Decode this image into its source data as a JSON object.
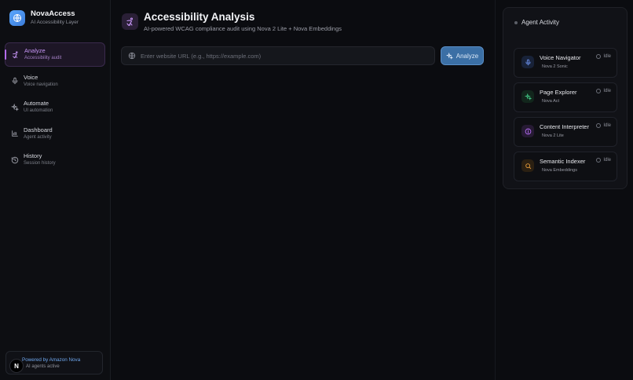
{
  "brand": {
    "title": "NovaAccess",
    "subtitle": "AI Accessibility Layer"
  },
  "sidebar": {
    "items": [
      {
        "label": "Analyze",
        "sub": "Accessibility audit",
        "icon": "accessibility-icon",
        "active": true
      },
      {
        "label": "Voice",
        "sub": "Voice navigation",
        "icon": "microphone-icon"
      },
      {
        "label": "Automate",
        "sub": "UI automation",
        "icon": "sparkle-icon"
      },
      {
        "label": "Dashboard",
        "sub": "Agent activity",
        "icon": "bar-chart-icon"
      },
      {
        "label": "History",
        "sub": "Session history",
        "icon": "history-icon"
      }
    ],
    "footer": {
      "avatar": "N",
      "title": "Powered by Amazon Nova",
      "subtitle": "AI agents active"
    }
  },
  "main": {
    "title": "Accessibility Analysis",
    "subtitle": "AI-powered WCAG compliance audit using Nova 2 Lite + Nova Embeddings",
    "url_placeholder": "Enter website URL (e.g., https://example.com)",
    "url_value": "",
    "analyze_label": "Analyze"
  },
  "agent_panel": {
    "title": "Agent Activity",
    "agents": [
      {
        "name": "Voice Navigator",
        "model": "Nova 2 Sonic",
        "status": "Idle",
        "icon": "microphone-icon",
        "color": "#6a8fe8"
      },
      {
        "name": "Page Explorer",
        "model": "Nova Act",
        "status": "Idle",
        "icon": "sparkle-icon",
        "color": "#3fbf7f"
      },
      {
        "name": "Content Interpreter",
        "model": "Nova 2 Lite",
        "status": "Idle",
        "icon": "info-icon",
        "color": "#b46cf4"
      },
      {
        "name": "Semantic Indexer",
        "model": "Nova Embeddings",
        "status": "Idle",
        "icon": "search-icon",
        "color": "#e39a3b"
      }
    ]
  },
  "colors": {
    "accent": "#b46cf4",
    "primary_button": "#3b6fa5",
    "background": "#0b0c10"
  }
}
